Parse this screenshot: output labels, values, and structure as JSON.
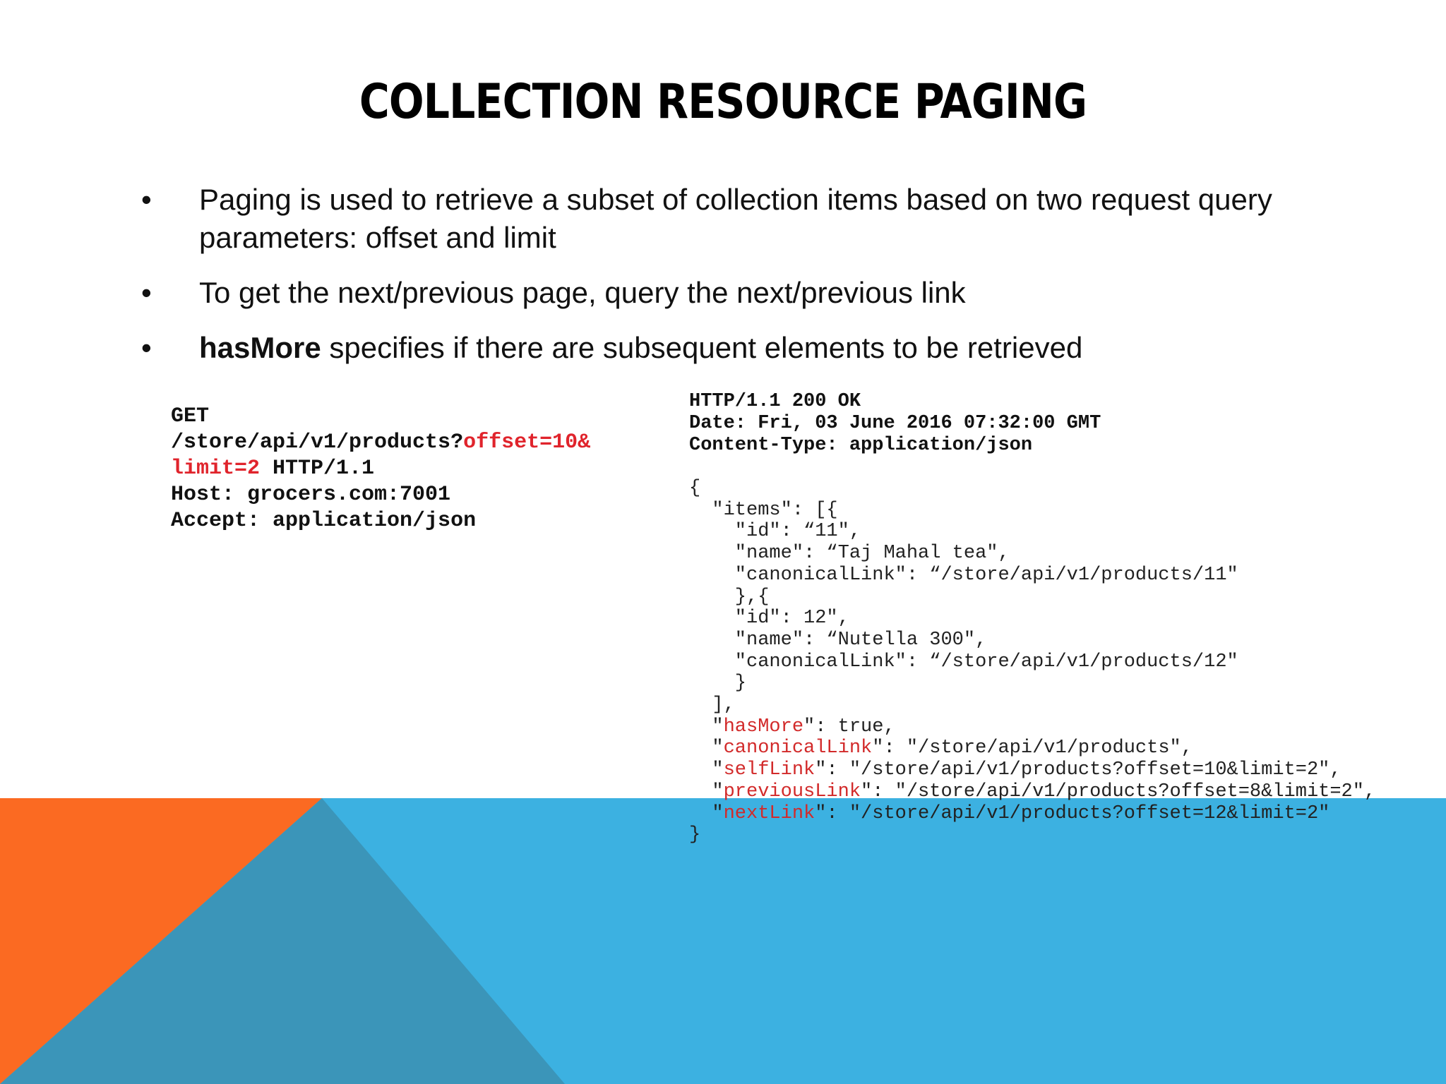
{
  "slide": {
    "title": "COLLECTION RESOURCE PAGING",
    "bullet_marker": "•",
    "bullets": [
      {
        "bold": "",
        "text": "Paging is used to retrieve a subset of collection items based on two request query parameters: offset and limit"
      },
      {
        "bold": "",
        "text": "To get the next/previous page, query the next/previous link"
      },
      {
        "bold": "hasMore",
        "text": " specifies if there are subsequent elements to be retrieved"
      }
    ]
  },
  "request": {
    "method": "GET",
    "path": "/store/api/v1/products?",
    "param_offset": "offset=10&",
    "param_limit": "limit=2",
    "protocol": " HTTP/1.1",
    "host": "Host: grocers.com:7001",
    "accept": "Accept: application/json"
  },
  "response": {
    "status": "HTTP/1.1 200 OK",
    "date": "Date: Fri, 03 June 2016 07:32:00 GMT",
    "content_type": "Content-Type: application/json",
    "body": {
      "open": "{",
      "items_open": "  \"items\": [{",
      "item1_id": "    \"id\": “11\",",
      "item1_name": "    \"name\": “Taj Mahal tea\",",
      "item1_link": "    \"canonicalLink\": “/store/api/v1/products/11\"",
      "item_sep": "    },{",
      "item2_id": "    \"id\": 12\",",
      "item2_name": "    \"name\": “Nutella 300\",",
      "item2_link": "    \"canonicalLink\": “/store/api/v1/products/12\"",
      "item2_close": "    }",
      "items_close": "  ],",
      "hasMore_key": "hasMore",
      "hasMore_rest": "\": true,",
      "canonical_key": "canonicalLink",
      "canonical_rest": "\": \"/store/api/v1/products\",",
      "self_key": "selfLink",
      "self_rest": "\": \"/store/api/v1/products?offset=10&limit=2\",",
      "previous_key": "previousLink",
      "previous_rest": "\": \"/store/api/v1/products?offset=8&limit=2\",",
      "next_key": "nextLink",
      "next_rest": "\": \"/store/api/v1/products?offset=12&limit=2\"",
      "close": "}"
    }
  },
  "colors": {
    "accent_blue": "#3cb1e1",
    "accent_orange": "#fb6a22",
    "shade_blue": "#3b95b9",
    "highlight_red": "#e0242c"
  }
}
